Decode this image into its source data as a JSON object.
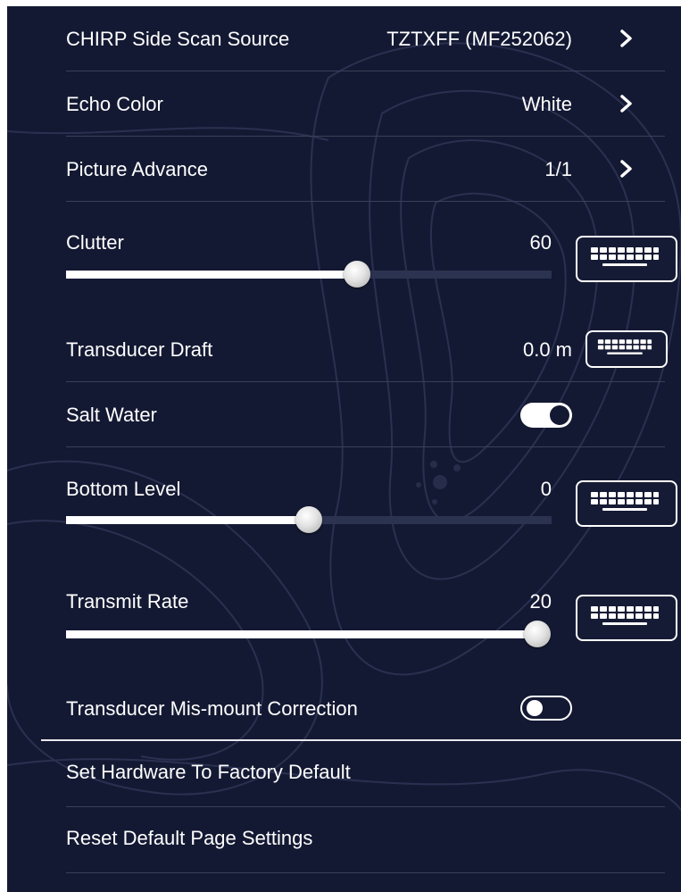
{
  "settings": {
    "chirp_source": {
      "label": "CHIRP Side Scan Source",
      "value": "TZTXFF (MF252062)"
    },
    "echo_color": {
      "label": "Echo Color",
      "value": "White"
    },
    "picture_advance": {
      "label": "Picture Advance",
      "value": "1/1"
    },
    "clutter": {
      "label": "Clutter",
      "value": "60",
      "fill_fraction": 0.6
    },
    "transducer_draft": {
      "label": "Transducer Draft",
      "value": "0.0 m"
    },
    "salt_water": {
      "label": "Salt Water",
      "state": "on"
    },
    "bottom_level": {
      "label": "Bottom Level",
      "value": "0",
      "fill_fraction": 0.5
    },
    "transmit_rate": {
      "label": "Transmit Rate",
      "value": "20",
      "fill_fraction": 1.0
    },
    "mis_mount": {
      "label": "Transducer Mis-mount Correction",
      "state": "off"
    },
    "factory_default": {
      "label": "Set Hardware To Factory Default"
    },
    "reset_page": {
      "label": "Reset Default Page Settings"
    }
  },
  "icons": {
    "chevron": "chevron-right-icon",
    "keyboard": "keyboard-icon"
  },
  "colors": {
    "background": "#141933",
    "text": "#ffffff",
    "divider": "#3a4057",
    "track": "#2c3350"
  }
}
